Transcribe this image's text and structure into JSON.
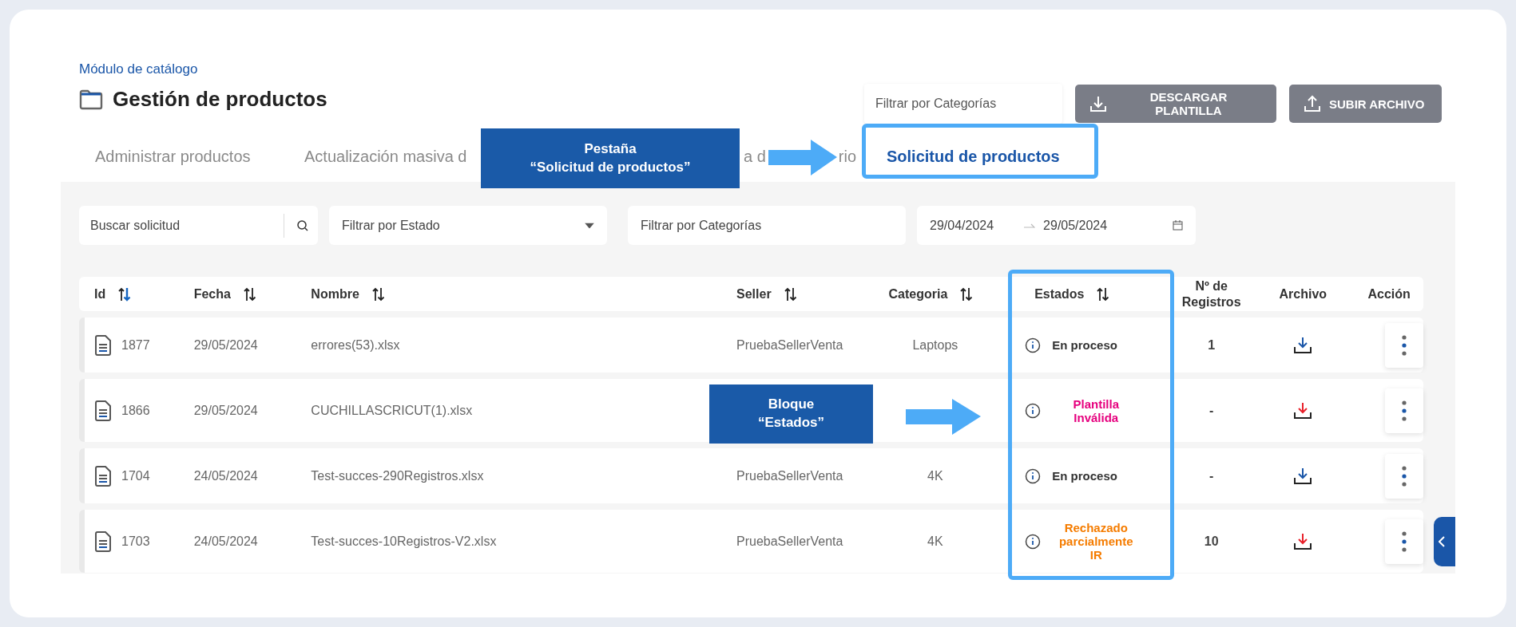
{
  "breadcrumb": "Módulo de catálogo",
  "title": "Gestión de productos",
  "header_filter": {
    "placeholder": "Filtrar por Categorías"
  },
  "header_buttons": [
    {
      "label": "DESCARGAR PLANTILLA",
      "kind": "download"
    },
    {
      "label": "SUBIR ARCHIVO",
      "kind": "upload"
    }
  ],
  "tabs": [
    {
      "label": "Administrar productos",
      "selected": false
    },
    {
      "label": "Actualización masiva d",
      "selected": false
    },
    {
      "label": "a d",
      "label_end": "rio",
      "selected": false
    },
    {
      "label": "Solicitud de productos",
      "selected": true
    }
  ],
  "filters": {
    "search": {
      "placeholder": "Buscar solicitud"
    },
    "status": {
      "placeholder": "Filtrar por Estado"
    },
    "categories": {
      "placeholder": "Filtrar por Categorías"
    },
    "date_from": "29/04/2024",
    "date_to": "29/05/2024"
  },
  "table": {
    "columns": [
      {
        "label": "Id",
        "sortable": true,
        "sort_active": true
      },
      {
        "label": "Fecha",
        "sortable": true,
        "sort_active": false
      },
      {
        "label": "Nombre",
        "sortable": true,
        "sort_active": false
      },
      {
        "label": "Seller",
        "sortable": true,
        "sort_active": false
      },
      {
        "label": "Categoria",
        "sortable": true,
        "sort_active": false
      },
      {
        "label": "Estados",
        "sortable": true,
        "sort_active": false
      },
      {
        "label": "Nº de Registros",
        "sortable": false
      },
      {
        "label": "Archivo",
        "sortable": false
      },
      {
        "label": "Acción",
        "sortable": false
      }
    ],
    "rows": [
      {
        "id": "1877",
        "date": "29/05/2024",
        "name": "errores(53).xlsx",
        "seller": "PruebaSellerVenta",
        "category": "Laptops",
        "status": {
          "text": "En proceso",
          "color": "#333333"
        },
        "records": "1",
        "file": {
          "color": "#1a56a8"
        }
      },
      {
        "id": "1866",
        "date": "29/05/2024",
        "name": "CUCHILLASCRICUT(1).xlsx",
        "status": {
          "text": "Plantilla Inválida",
          "color": "#e6007e"
        },
        "records": "-",
        "file": {
          "color": "#e8202a"
        }
      },
      {
        "id": "1704",
        "date": "24/05/2024",
        "name": "Test-succes-290Registros.xlsx",
        "seller": "PruebaSellerVenta",
        "category": "4K",
        "status": {
          "text": "En proceso",
          "color": "#333333"
        },
        "records": "-",
        "file": {
          "color": "#1a56a8"
        }
      },
      {
        "id": "1703",
        "date": "24/05/2024",
        "name": "Test-succes-10Registros-V2.xlsx",
        "seller": "PruebaSellerVenta",
        "category": "4K",
        "status": {
          "text": "Rechazado parcialmente IR",
          "color": "#f57c00"
        },
        "records": "10",
        "file": {
          "color": "#e8202a"
        }
      }
    ]
  },
  "annotations": [
    {
      "kind": "tab",
      "lines": [
        "Pestaña",
        "“Solicitud de productos”"
      ]
    },
    {
      "kind": "column",
      "lines": [
        "Bloque",
        "“Estados”"
      ]
    }
  ]
}
